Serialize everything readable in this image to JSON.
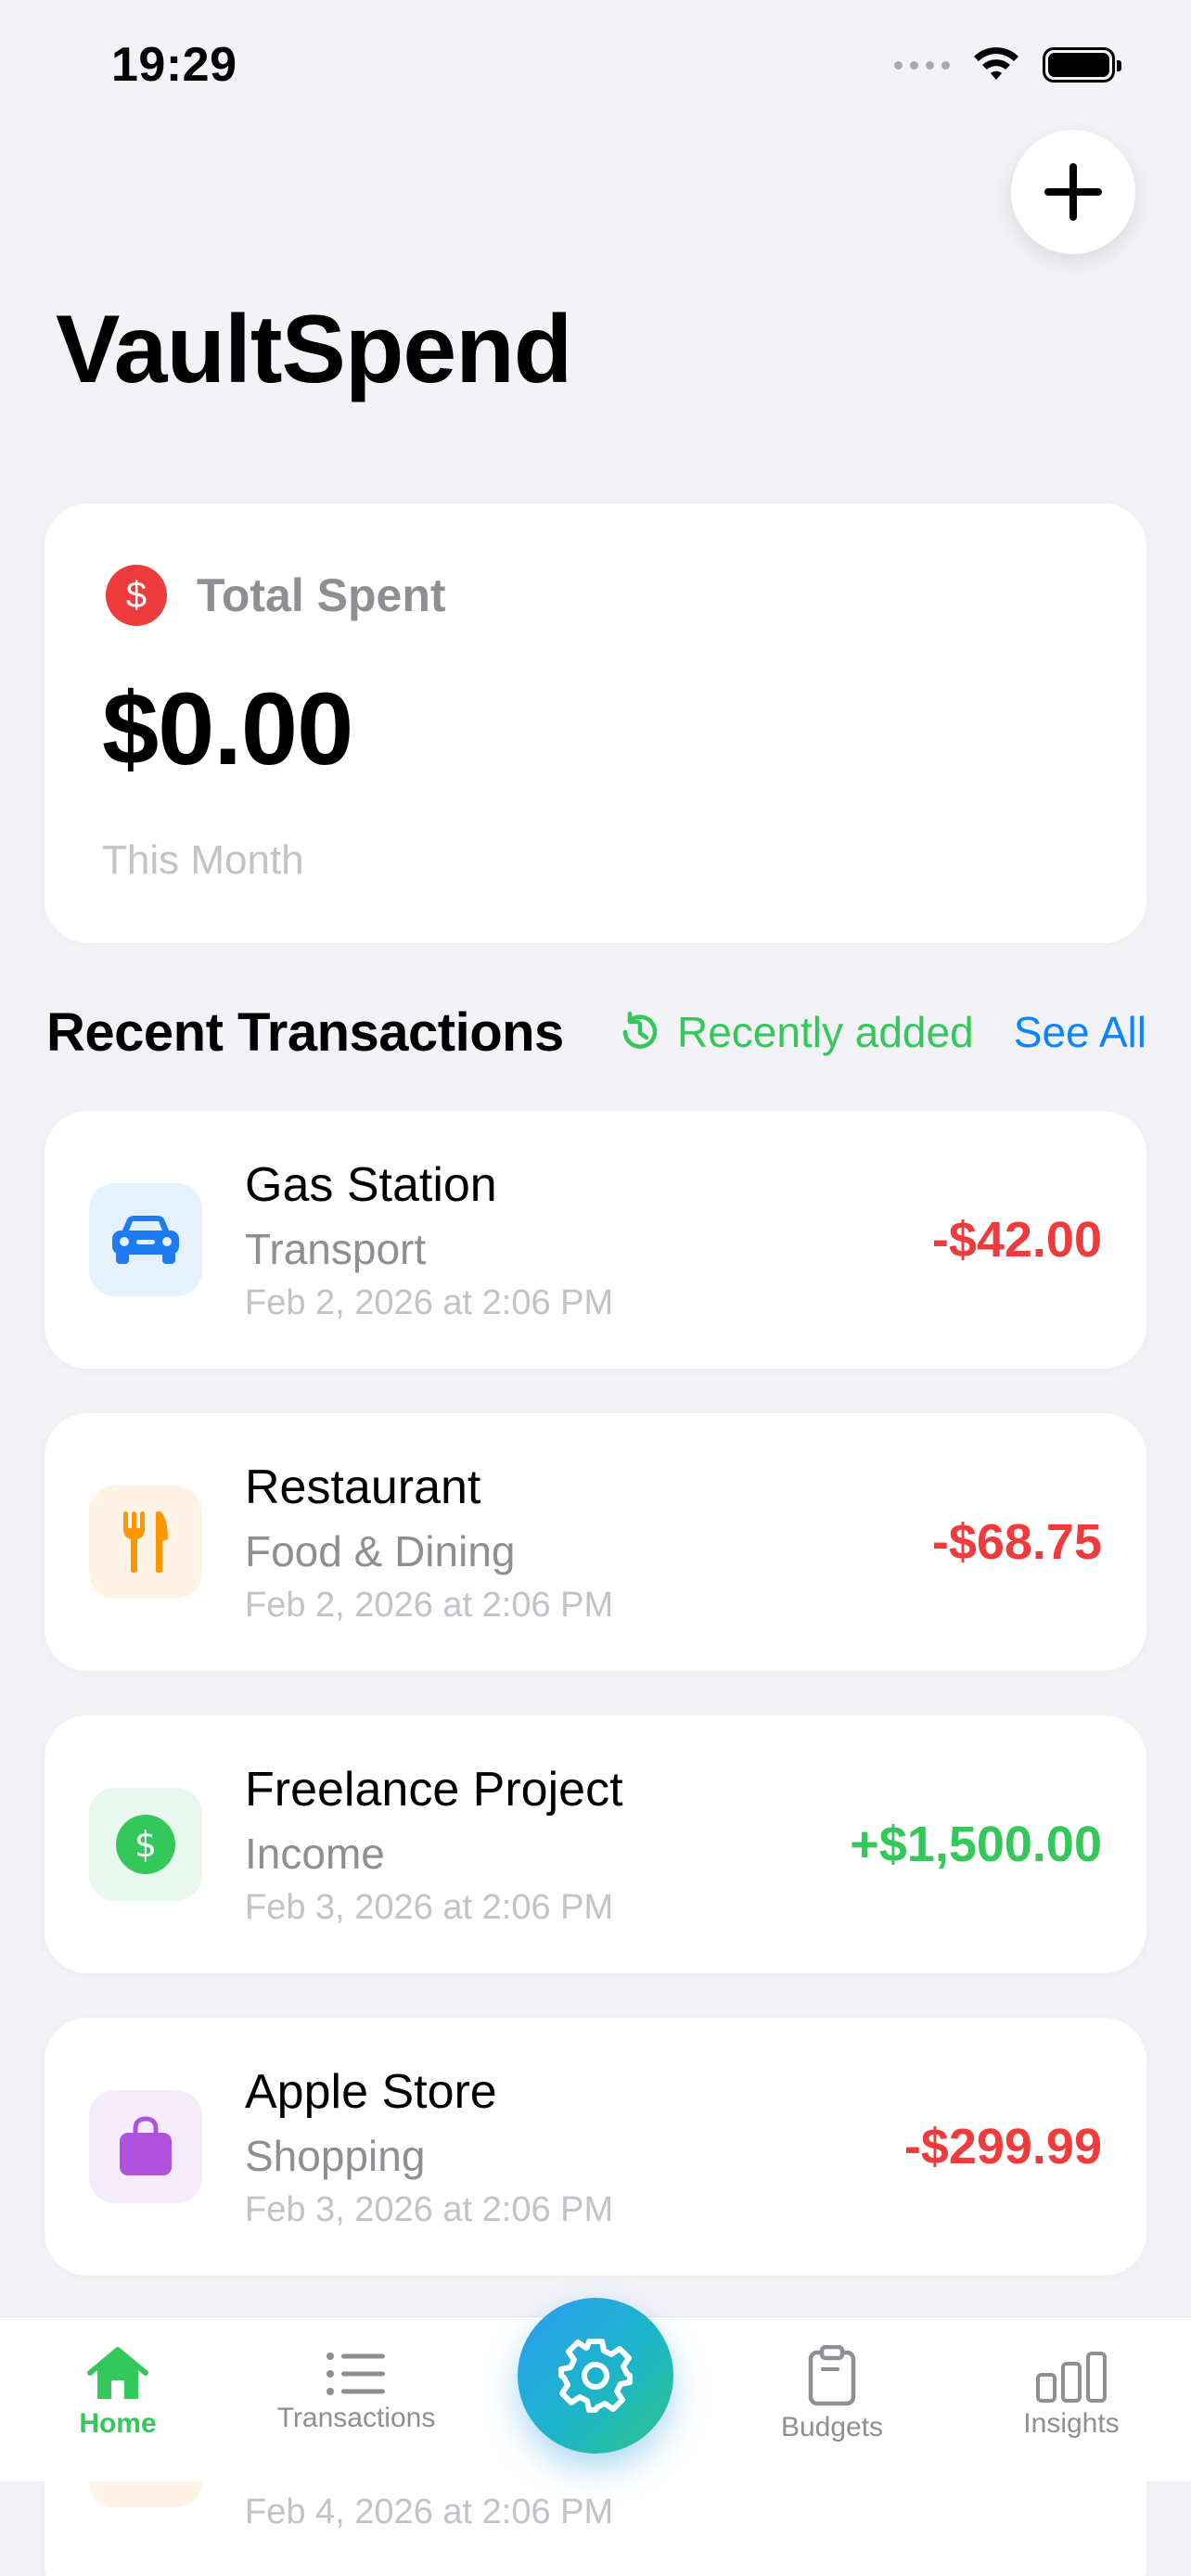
{
  "status_bar": {
    "time": "19:29"
  },
  "header": {
    "title": "VaultSpend"
  },
  "summary": {
    "label": "Total Spent",
    "amount": "$0.00",
    "period": "This Month",
    "icon": "dollar-circle-icon",
    "icon_color": "#ef3b3b"
  },
  "recent": {
    "title": "Recent Transactions",
    "sort_label": "Recently added",
    "see_all": "See All"
  },
  "transactions": [
    {
      "name": "Gas Station",
      "category": "Transport",
      "date": "Feb 2, 2026 at 2:06 PM",
      "amount": "-$42.00",
      "icon": "car-icon",
      "icon_color": "#1e7bf2",
      "icon_bg": "#e6f1fe"
    },
    {
      "name": "Restaurant",
      "category": "Food & Dining",
      "date": "Feb 2, 2026 at 2:06 PM",
      "amount": "-$68.75",
      "icon": "fork-knife-icon",
      "icon_color": "#ff9500",
      "icon_bg": "#fff3e6"
    },
    {
      "name": "Freelance Project",
      "category": "Income",
      "date": "Feb 3, 2026 at 2:06 PM",
      "amount": "+$1,500.00",
      "icon": "dollar-circle-icon",
      "icon_color": "#34c759",
      "icon_bg": "#e9f8ee"
    },
    {
      "name": "Apple Store",
      "category": "Shopping",
      "date": "Feb 3, 2026 at 2:06 PM",
      "amount": "-$299.99",
      "icon": "shopping-bag-icon",
      "icon_color": "#af52de",
      "icon_bg": "#f5ecfb"
    },
    {
      "date": "Feb 4, 2026 at 2:06 PM"
    }
  ],
  "tab_bar": {
    "tabs": [
      {
        "label": "Home",
        "icon": "house-icon",
        "active": true
      },
      {
        "label": "Transactions",
        "icon": "list-icon"
      },
      {
        "label": "Budgets",
        "icon": "clipboard-icon"
      },
      {
        "label": "Insights",
        "icon": "bar-chart-icon"
      }
    ],
    "center_icon": "gear-icon"
  },
  "colors": {
    "accent_green": "#34c759",
    "link_blue": "#0a84ff",
    "negative_red": "#ef3b3b"
  }
}
